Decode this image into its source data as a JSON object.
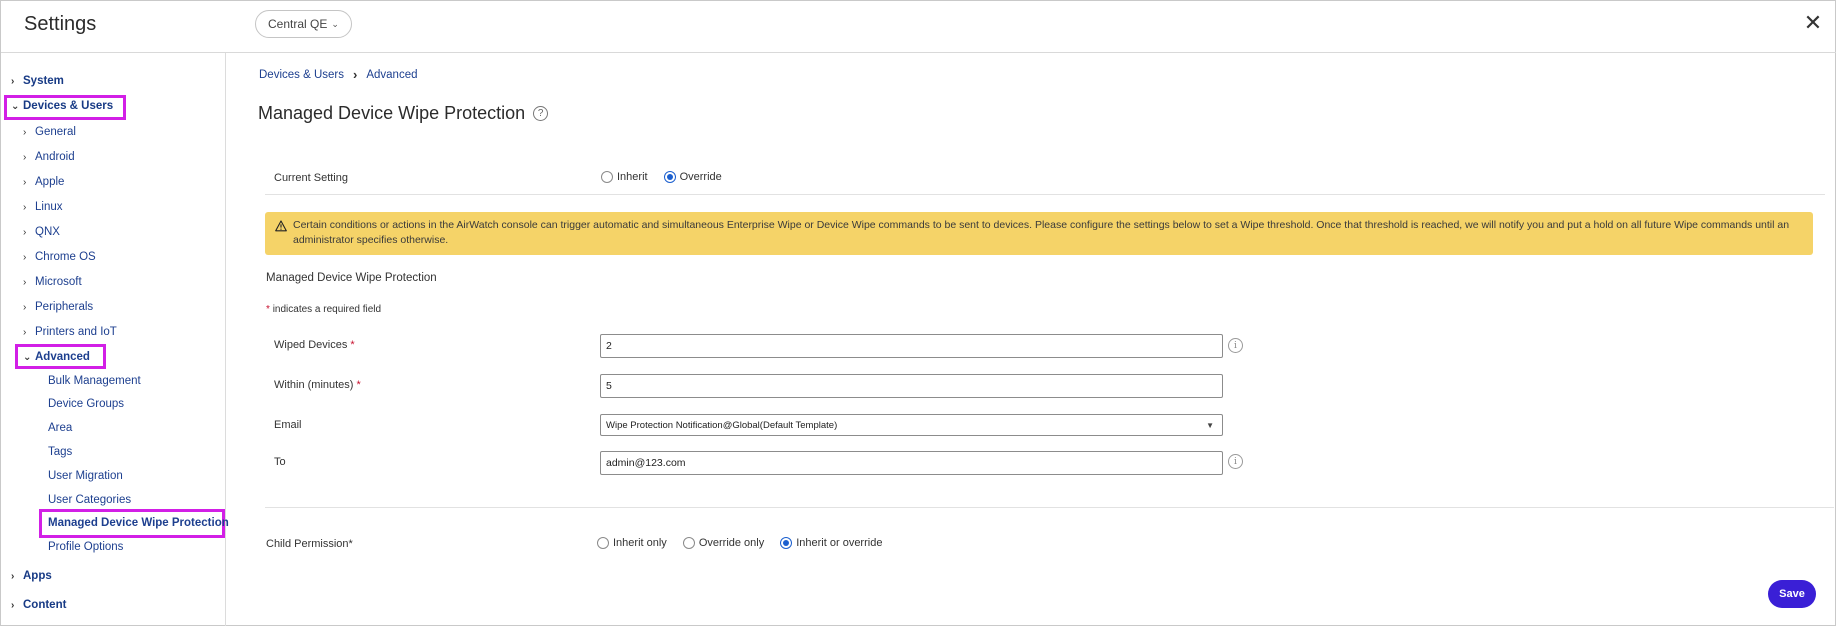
{
  "header": {
    "title": "Settings",
    "org_selector": "Central QE",
    "close_icon": "close-icon"
  },
  "sidebar": {
    "system": "System",
    "devices_users": "Devices & Users",
    "general": "General",
    "android": "Android",
    "apple": "Apple",
    "linux": "Linux",
    "qnx": "QNX",
    "chrome_os": "Chrome OS",
    "microsoft": "Microsoft",
    "peripherals": "Peripherals",
    "printers_iot": "Printers and IoT",
    "advanced": "Advanced",
    "bulk_management": "Bulk Management",
    "device_groups": "Device Groups",
    "area": "Area",
    "tags": "Tags",
    "user_migration": "User Migration",
    "user_categories": "User Categories",
    "managed_wipe": "Managed Device Wipe Protection",
    "profile_options": "Profile Options",
    "apps": "Apps",
    "content": "Content"
  },
  "breadcrumb": {
    "root": "Devices & Users",
    "current": "Advanced"
  },
  "page": {
    "title": "Managed Device Wipe Protection"
  },
  "current_setting": {
    "label": "Current Setting",
    "options": [
      "Inherit",
      "Override"
    ],
    "selected": "Override"
  },
  "warning": {
    "text": "Certain conditions or actions in the AirWatch console can trigger automatic and simultaneous Enterprise Wipe or Device Wipe commands to be sent to devices. Please configure the settings below to set a Wipe threshold. Once that threshold is reached, we will notify you and put a hold on all future Wipe commands until an administrator specifies otherwise."
  },
  "section": {
    "title": "Managed Device Wipe Protection",
    "required_note": "indicates a required field",
    "required_star": "*"
  },
  "form": {
    "wiped_devices_label": "Wiped Devices",
    "wiped_devices_value": "2",
    "within_label": "Within (minutes)",
    "within_value": "5",
    "email_label": "Email",
    "email_value": "Wipe Protection Notification@Global(Default Template)",
    "to_label": "To",
    "to_value": "admin@123.com"
  },
  "child_permission": {
    "label": "Child Permission*",
    "options": [
      "Inherit only",
      "Override only",
      "Inherit or override"
    ],
    "selected": "Inherit or override"
  },
  "actions": {
    "save": "Save"
  },
  "colors": {
    "accent": "#3a1fd6",
    "link": "#1d3f8f",
    "warning_bg": "#f5d368",
    "highlight": "#d21fe6",
    "radio_selected": "#1b5fcf"
  }
}
